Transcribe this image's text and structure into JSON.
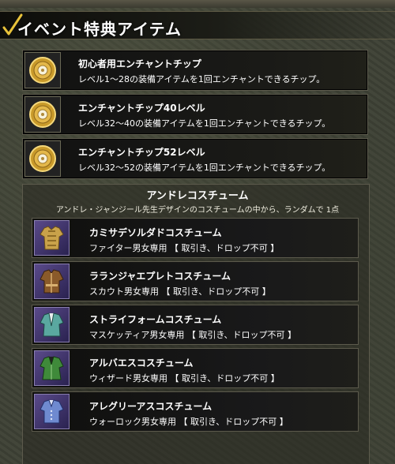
{
  "header": {
    "title": "イベント特典アイテム"
  },
  "event_items": [
    {
      "name": "初心者用エンチャントチップ",
      "description": "レベル1～28の装備アイテムを1回エンチャントできるチップ。",
      "icon": "gold-chip-icon"
    },
    {
      "name": "エンチャントチップ40レベル",
      "description": "レベル32～40の装備アイテムを1回エンチャントできるチップ。",
      "icon": "gold-chip-icon"
    },
    {
      "name": "エンチャントチップ52レベル",
      "description": "レベル32～52の装備アイテムを1回エンチャントできるチップ。",
      "icon": "gold-chip-icon"
    }
  ],
  "costume_section": {
    "title": "アンドレコスチューム",
    "subtitle": "アンドレ・ジャンジール先生デザインのコスチュームの中から、ランダムで 1点",
    "items": [
      {
        "name": "カミサデソルダドコスチューム",
        "description": "ファイター男女専用 【 取引き、ドロップ不可 】",
        "icon": "gold-armor-costume-icon",
        "color": "#c9a24a"
      },
      {
        "name": "ラランジャエプレトコスチューム",
        "description": "スカウト男女専用 【 取引き、ドロップ不可 】",
        "icon": "brown-jacket-costume-icon",
        "color": "#8a5a2a"
      },
      {
        "name": "ストライフォームコスチューム",
        "description": "マスケッティア男女専用 【 取引き、ドロップ不可 】",
        "icon": "teal-coat-costume-icon",
        "color": "#5aa8a0"
      },
      {
        "name": "アルバエスコスチューム",
        "description": "ウィザード男女専用 【 取引き、ドロップ不可 】",
        "icon": "green-robe-costume-icon",
        "color": "#3f8a3a"
      },
      {
        "name": "アレグリーアスコスチューム",
        "description": "ウォーロック男女専用 【 取引き、ドロップ不可 】",
        "icon": "blue-vest-costume-icon",
        "color": "#6f8ad0"
      }
    ]
  },
  "colors": {
    "background": "#3f4236",
    "panel": "#111111",
    "border": "#5c5a4c",
    "accent_check": "#e8c23a"
  }
}
